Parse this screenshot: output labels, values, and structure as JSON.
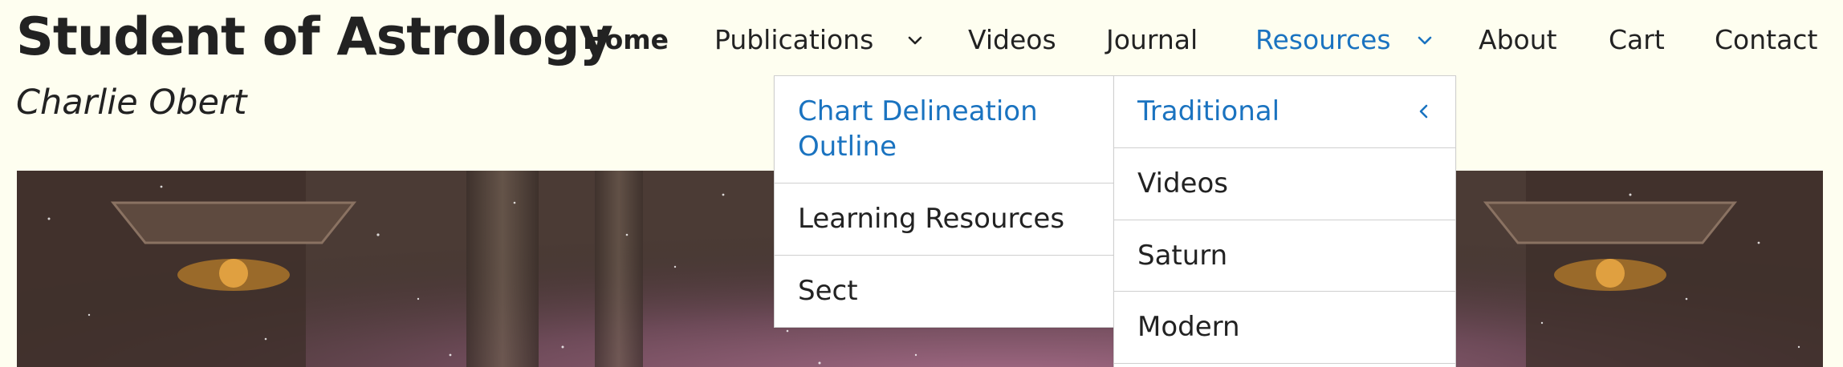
{
  "header": {
    "title": "Student of Astrology",
    "subtitle": "Charlie Obert"
  },
  "nav": {
    "items": [
      {
        "label": "Home"
      },
      {
        "label": "Publications"
      },
      {
        "label": "Videos"
      },
      {
        "label": "Journal"
      },
      {
        "label": "Resources"
      },
      {
        "label": "About"
      },
      {
        "label": "Cart"
      },
      {
        "label": "Contact"
      }
    ],
    "active": "Resources"
  },
  "resources_menu": {
    "items": [
      {
        "label": "Chart Delineation Outline"
      },
      {
        "label": "Learning Resources"
      },
      {
        "label": "Sect"
      }
    ]
  },
  "traditional_menu": {
    "items": [
      {
        "label": "Traditional"
      },
      {
        "label": "Videos"
      },
      {
        "label": "Saturn"
      },
      {
        "label": "Modern"
      }
    ]
  },
  "colors": {
    "background": "#fefef0",
    "text": "#222222",
    "accent": "#1a73c0"
  },
  "icons": [
    "chevron-down-icon",
    "chevron-left-icon"
  ]
}
